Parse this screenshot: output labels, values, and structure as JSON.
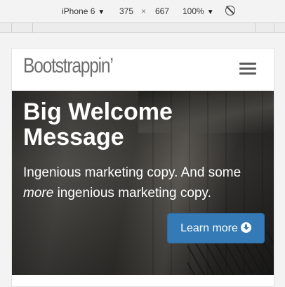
{
  "devtools": {
    "device": "iPhone 6",
    "width": "375",
    "times": "×",
    "height": "667",
    "zoom": "100%",
    "rotate_icon": "no-throttle-icon"
  },
  "page": {
    "brand": "Bootstrappin’",
    "menu_icon": "hamburger-icon",
    "hero": {
      "headline_bold": "Big",
      "headline_rest": " Welcome Message",
      "copy_1": "Ingenious marketing copy. And some ",
      "copy_em": "more",
      "copy_2": " ingenious marketing copy.",
      "button_label": "Learn more",
      "button_icon": "circle-arrow-down-icon",
      "button_color": "#337ab7"
    }
  }
}
